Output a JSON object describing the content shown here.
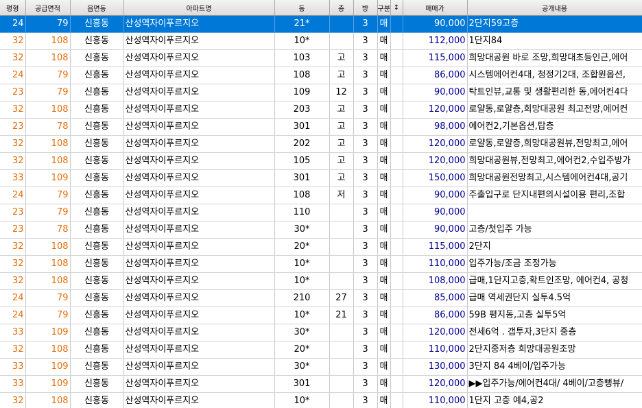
{
  "columns": [
    "평형",
    "공급면적",
    "읍면동",
    "아파트명",
    "동",
    "층",
    "방",
    "구분",
    "↕",
    "매매가",
    "공개내용"
  ],
  "selected_row": 0,
  "colors": {
    "selection": "#0078d7",
    "area": "#e36c09",
    "price": "#000090"
  },
  "rows": [
    {
      "pyeong": "24",
      "area": "79",
      "dong_area": "신흥동",
      "apt": "산성역자이푸르지오",
      "bldg": "21*",
      "floor": "",
      "room": "3",
      "type": "매",
      "sort": "",
      "price": "90,000",
      "desc": "2단지59고층"
    },
    {
      "pyeong": "32",
      "area": "108",
      "dong_area": "신흥동",
      "apt": "산성역자이푸르지오",
      "bldg": "10*",
      "floor": "",
      "room": "3",
      "type": "매",
      "sort": "",
      "price": "112,000",
      "desc": "1단지84"
    },
    {
      "pyeong": "32",
      "area": "108",
      "dong_area": "신흥동",
      "apt": "산성역자이푸르지오",
      "bldg": "103",
      "floor": "고",
      "room": "3",
      "type": "매",
      "sort": "",
      "price": "115,000",
      "desc": "희망대공원 바로 조망,희망대초등인근,에어"
    },
    {
      "pyeong": "24",
      "area": "79",
      "dong_area": "신흥동",
      "apt": "산성역자이푸르지오",
      "bldg": "108",
      "floor": "고",
      "room": "3",
      "type": "매",
      "sort": "",
      "price": "86,000",
      "desc": "시스템에어컨4대, 청정기2대, 조합원옵션,"
    },
    {
      "pyeong": "23",
      "area": "79",
      "dong_area": "신흥동",
      "apt": "산성역자이푸르지오",
      "bldg": "109",
      "floor": "12",
      "room": "3",
      "type": "매",
      "sort": "",
      "price": "90,000",
      "desc": "탁트인뷰,교통 및 생활편리한 동,에어컨4다"
    },
    {
      "pyeong": "32",
      "area": "108",
      "dong_area": "신흥동",
      "apt": "산성역자이푸르지오",
      "bldg": "203",
      "floor": "고",
      "room": "3",
      "type": "매",
      "sort": "",
      "price": "120,000",
      "desc": "로얄동,로얄층,희망대공원 최고전망,에어컨"
    },
    {
      "pyeong": "23",
      "area": "78",
      "dong_area": "신흥동",
      "apt": "산성역자이푸르지오",
      "bldg": "301",
      "floor": "고",
      "room": "3",
      "type": "매",
      "sort": "",
      "price": "98,000",
      "desc": "에어컨2,기본옵션,탑층"
    },
    {
      "pyeong": "32",
      "area": "108",
      "dong_area": "신흥동",
      "apt": "산성역자이푸르지오",
      "bldg": "202",
      "floor": "고",
      "room": "3",
      "type": "매",
      "sort": "",
      "price": "120,000",
      "desc": "로얄동,로얄층,희망대공원뷰,전망최고,에어"
    },
    {
      "pyeong": "32",
      "area": "108",
      "dong_area": "신흥동",
      "apt": "산성역자이푸르지오",
      "bldg": "105",
      "floor": "고",
      "room": "3",
      "type": "매",
      "sort": "",
      "price": "120,000",
      "desc": "희망대공원뷰,전망최고,에어컨2,수입주방가"
    },
    {
      "pyeong": "33",
      "area": "109",
      "dong_area": "신흥동",
      "apt": "산성역자이푸르지오",
      "bldg": "301",
      "floor": "고",
      "room": "3",
      "type": "매",
      "sort": "",
      "price": "150,000",
      "desc": "희망대공원전망최고,시스템에어컨4대,공기"
    },
    {
      "pyeong": "24",
      "area": "79",
      "dong_area": "신흥동",
      "apt": "산성역자이푸르지오",
      "bldg": "108",
      "floor": "저",
      "room": "3",
      "type": "매",
      "sort": "",
      "price": "90,000",
      "desc": "주출입구로 단지내편의시설이용 편리,조합"
    },
    {
      "pyeong": "23",
      "area": "79",
      "dong_area": "신흥동",
      "apt": "산성역자이푸르지오",
      "bldg": "110",
      "floor": "",
      "room": "3",
      "type": "매",
      "sort": "",
      "price": "90,000",
      "desc": ""
    },
    {
      "pyeong": "23",
      "area": "78",
      "dong_area": "신흥동",
      "apt": "산성역자이푸르지오",
      "bldg": "30*",
      "floor": "",
      "room": "3",
      "type": "매",
      "sort": "",
      "price": "90,000",
      "desc": "고층/첫입주 가능"
    },
    {
      "pyeong": "32",
      "area": "108",
      "dong_area": "신흥동",
      "apt": "산성역자이푸르지오",
      "bldg": "20*",
      "floor": "",
      "room": "3",
      "type": "매",
      "sort": "",
      "price": "115,000",
      "desc": "2단지"
    },
    {
      "pyeong": "32",
      "area": "108",
      "dong_area": "신흥동",
      "apt": "산성역자이푸르지오",
      "bldg": "10*",
      "floor": "",
      "room": "3",
      "type": "매",
      "sort": "",
      "price": "110,000",
      "desc": "입주가능/조금 조정가능"
    },
    {
      "pyeong": "32",
      "area": "108",
      "dong_area": "신흥동",
      "apt": "산성역자이푸르지오",
      "bldg": "10*",
      "floor": "",
      "room": "3",
      "type": "매",
      "sort": "",
      "price": "108,000",
      "desc": "급매,1단지고층,확트인조망, 에어컨4, 공청"
    },
    {
      "pyeong": "24",
      "area": "79",
      "dong_area": "신흥동",
      "apt": "산성역자이푸르지오",
      "bldg": "210",
      "floor": "27",
      "room": "3",
      "type": "매",
      "sort": "",
      "price": "85,000",
      "desc": "급매 역세권단지 실투4.5억"
    },
    {
      "pyeong": "24",
      "area": "79",
      "dong_area": "신흥동",
      "apt": "산성역자이푸르지오",
      "bldg": "10*",
      "floor": "21",
      "room": "3",
      "type": "매",
      "sort": "",
      "price": "86,000",
      "desc": "59B 평지동,고층 실투5억"
    },
    {
      "pyeong": "33",
      "area": "109",
      "dong_area": "신흥동",
      "apt": "산성역자이푸르지오",
      "bldg": "30*",
      "floor": "",
      "room": "3",
      "type": "매",
      "sort": "",
      "price": "120,000",
      "desc": "전세6억 . 갭투자,3단지 중층"
    },
    {
      "pyeong": "32",
      "area": "108",
      "dong_area": "신흥동",
      "apt": "산성역자이푸르지오",
      "bldg": "20*",
      "floor": "",
      "room": "3",
      "type": "매",
      "sort": "",
      "price": "110,000",
      "desc": "2단지중저층 희망대공원조망"
    },
    {
      "pyeong": "33",
      "area": "109",
      "dong_area": "신흥동",
      "apt": "산성역자이푸르지오",
      "bldg": "30*",
      "floor": "",
      "room": "3",
      "type": "매",
      "sort": "",
      "price": "130,000",
      "desc": "3단지 84 4베이/입주가능"
    },
    {
      "pyeong": "33",
      "area": "109",
      "dong_area": "신흥동",
      "apt": "산성역자이푸르지오",
      "bldg": "301",
      "floor": "",
      "room": "3",
      "type": "매",
      "sort": "",
      "price": "120,000",
      "desc": "▶▶입주가능/에어컨4대/ 4베이/고층뻥뷰/"
    },
    {
      "pyeong": "32",
      "area": "108",
      "dong_area": "신흥동",
      "apt": "산성역자이푸르지오",
      "bldg": "10*",
      "floor": "",
      "room": "3",
      "type": "매",
      "sort": "",
      "price": "110,000",
      "desc": "1단지 고층 예4,공2"
    }
  ]
}
